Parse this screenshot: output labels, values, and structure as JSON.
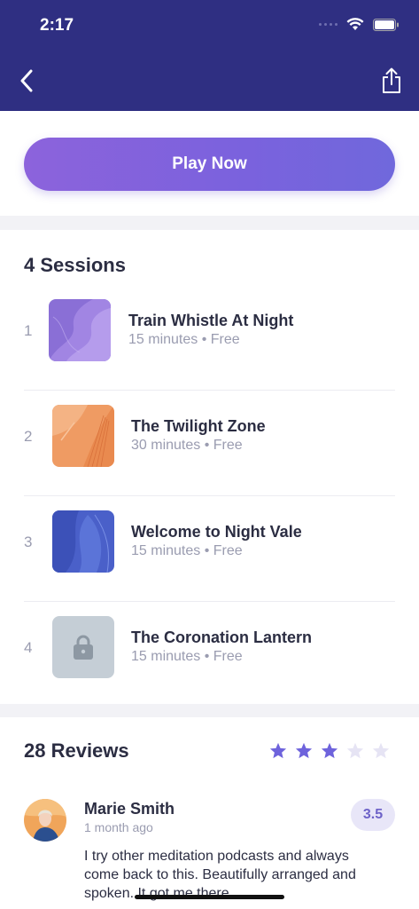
{
  "status_bar": {
    "time": "2:17"
  },
  "header": {
    "back_icon": "chevron-left-icon",
    "share_icon": "share-icon"
  },
  "play_button": {
    "label": "Play Now"
  },
  "sessions": {
    "title": "4 Sessions",
    "items": [
      {
        "number": "1",
        "title": "Train Whistle At Night",
        "meta": "15 minutes • Free",
        "thumb_color": "#8a6fd6",
        "locked": false
      },
      {
        "number": "2",
        "title": "The Twilight Zone",
        "meta": "30 minutes • Free",
        "thumb_color": "#ef9b63",
        "locked": false
      },
      {
        "number": "3",
        "title": "Welcome to Night Vale",
        "meta": "15 minutes • Free",
        "thumb_color": "#4a60c9",
        "locked": false
      },
      {
        "number": "4",
        "title": "The Coronation Lantern",
        "meta": "15 minutes • Free",
        "thumb_color": "#c5ced6",
        "locked": true
      }
    ]
  },
  "reviews": {
    "title": "28 Reviews",
    "average_rating": 3,
    "max_rating": 5,
    "star_color": "#6e63dc",
    "items": [
      {
        "name": "Marie Smith",
        "time": "1 month ago",
        "rating": "3.5",
        "text": "I try other meditation podcasts and always come back to this. Beautifully arranged and spoken. It got me there."
      }
    ]
  }
}
